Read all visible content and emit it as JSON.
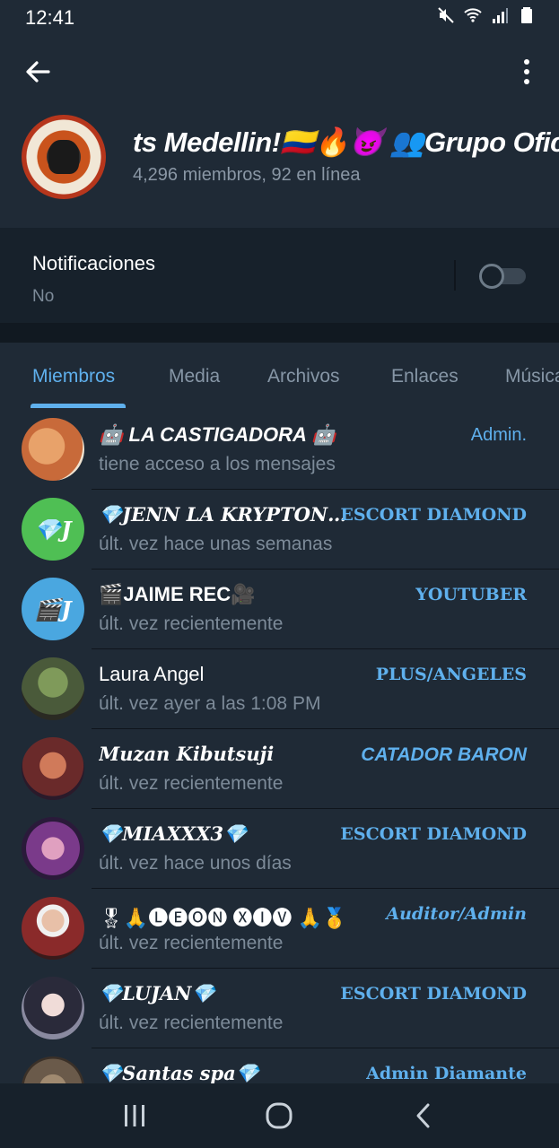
{
  "status_bar": {
    "time": "12:41"
  },
  "header": {
    "title": "ts Medellin!🇨🇴🔥😈   👥Grupo Oficial",
    "subtitle": "4,296 miembros, 92 en línea"
  },
  "notifications": {
    "label": "Notificaciones",
    "value": "No",
    "enabled": false
  },
  "tabs": [
    {
      "label": "Miembros",
      "active": true
    },
    {
      "label": "Media",
      "active": false
    },
    {
      "label": "Archivos",
      "active": false
    },
    {
      "label": "Enlaces",
      "active": false
    },
    {
      "label": "Música",
      "active": false
    }
  ],
  "members": [
    {
      "name": "🤖 LA CASTIGADORA 🤖",
      "status": "tiene acceso a los mensajes",
      "role": "Admin.",
      "avatar_color": "#c86a3a"
    },
    {
      "name": "💎JENN LA KRYPTON…",
      "status": "últ. vez hace unas semanas",
      "role": "ESCORT DIAMOND",
      "avatar_initial": "💎J",
      "avatar_color": "#4fbf54"
    },
    {
      "name": "🎬JAIME REC🎥",
      "status": "últ. vez recientemente",
      "role": "YOUTUBER",
      "avatar_initial": "🎬J",
      "avatar_color": "#4aa7e0"
    },
    {
      "name": "Laura Angel",
      "status": "últ. vez ayer a las 1:08 PM",
      "role": "PLUS/ANGELES",
      "avatar_color": "#4a5a3a"
    },
    {
      "name": "Muzan Kibutsuji",
      "status": "últ. vez recientemente",
      "role": "CATADOR BARON",
      "avatar_color": "#6a2a2a"
    },
    {
      "name": "💎MIAXXX3💎",
      "status": "últ. vez hace unos días",
      "role": "ESCORT DIAMOND",
      "avatar_color": "#7a3a8a"
    },
    {
      "name": "🎖🙏🅛🅔🅞🅝 🅧🅘🅥 🙏🥇",
      "status": "últ. vez recientemente",
      "role": "Auditor/Admin",
      "avatar_color": "#8a2a2a"
    },
    {
      "name": "💎LUJAN💎",
      "status": "últ. vez recientemente",
      "role": "ESCORT DIAMOND",
      "avatar_color": "#5a5a6a"
    },
    {
      "name": "💎Santas spa💎",
      "status": "",
      "role": "Admin Diamante",
      "avatar_color": "#6a5a4a"
    }
  ],
  "colors": {
    "accent": "#5fb0ed",
    "background": "#1f2a36",
    "muted": "#7d8b99"
  }
}
